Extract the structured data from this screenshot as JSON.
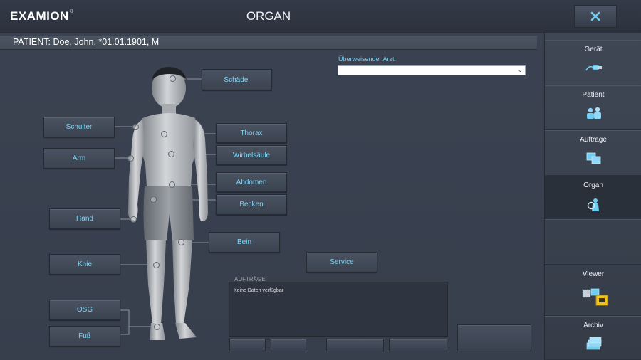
{
  "header": {
    "logo": "EXAMION",
    "logo_mark": "®",
    "title": "ORGAN"
  },
  "patient": {
    "text": "PATIENT: Doe, John, *01.01.1901, M"
  },
  "referrer": {
    "label": "Überweisender Arzt:",
    "value": ""
  },
  "organs": {
    "schaedel": "Schädel",
    "schulter": "Schulter",
    "thorax": "Thorax",
    "arm": "Arm",
    "wirbelsaeule": "Wirbelsäule",
    "abdomen": "Abdomen",
    "becken": "Becken",
    "hand": "Hand",
    "bein": "Bein",
    "knie": "Knie",
    "osg": "OSG",
    "fuss": "Fuß"
  },
  "service_label": "Service",
  "orders": {
    "title": "AUFTRÄGE",
    "empty": "Keine Daten verfügbar"
  },
  "sidebar": {
    "items": [
      {
        "label": "Gerät",
        "icon": "device-icon"
      },
      {
        "label": "Patient",
        "icon": "patients-icon"
      },
      {
        "label": "Aufträge",
        "icon": "orders-icon"
      },
      {
        "label": "Organ",
        "icon": "organ-icon",
        "active": true
      },
      {
        "label": "",
        "icon": ""
      },
      {
        "label": "Viewer",
        "icon": "viewer-icon"
      },
      {
        "label": "Archiv",
        "icon": "archive-icon"
      }
    ]
  },
  "colors": {
    "accent": "#6fcdf2",
    "background": "#3b4352",
    "panel": "#2f3540"
  }
}
